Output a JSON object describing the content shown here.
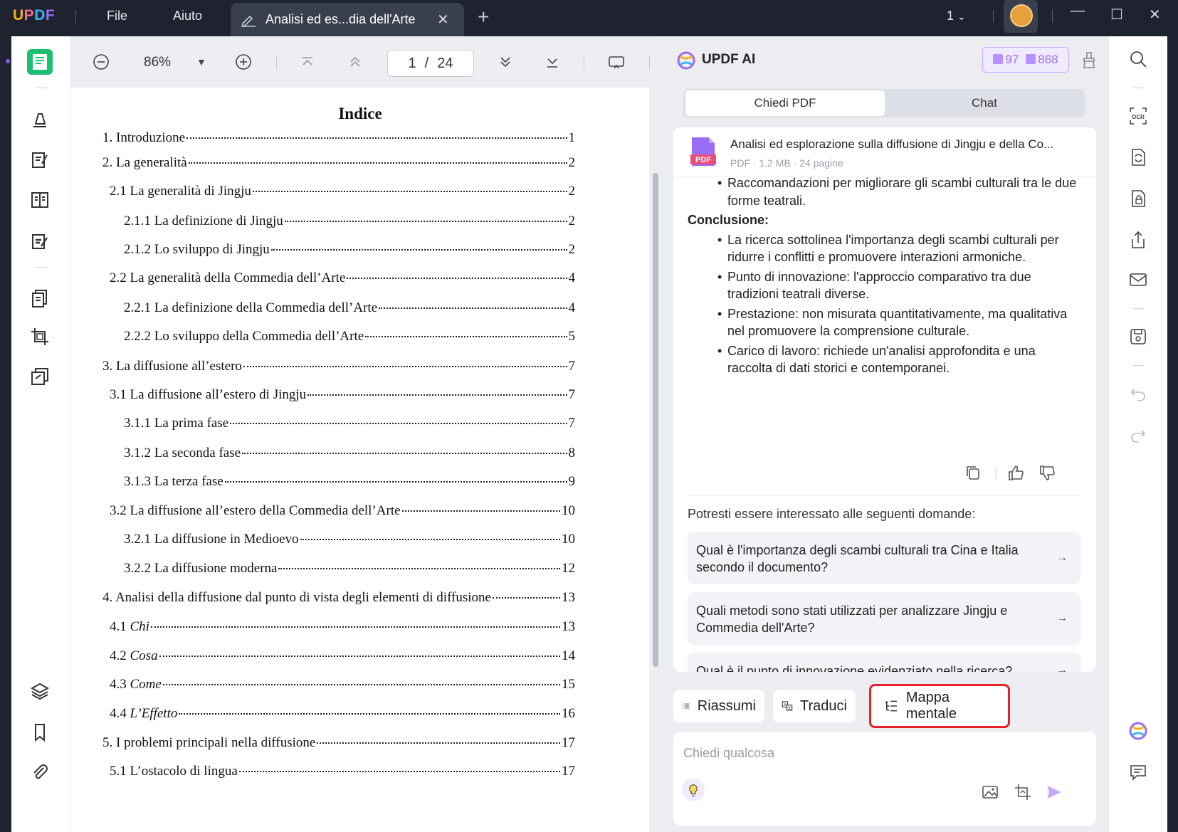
{
  "titlebar": {
    "menu_file": "File",
    "menu_help": "Aiuto",
    "tab_title": "Analisi ed es...dia dell'Arte",
    "page_count": "1",
    "icons": [
      "edit-icon",
      "close-icon",
      "plus-icon",
      "chevron-down-icon",
      "minimize-icon",
      "maximize-icon",
      "window-close-icon"
    ]
  },
  "viewer": {
    "zoom": "86%",
    "current_page": "1",
    "page_sep": "/",
    "total_pages": "24"
  },
  "toc": {
    "title": "Indice",
    "entries": [
      {
        "label": "1. Introduzione",
        "page": "1"
      },
      {
        "label": "2. La generalità",
        "page": "2"
      },
      {
        "label": "2.1 La generalità di Jingju",
        "page": "2"
      },
      {
        "label": "2.1.1 La definizione di Jingju",
        "page": "2"
      },
      {
        "label": "2.1.2 Lo sviluppo di Jingju",
        "page": "2"
      },
      {
        "label": "2.2 La generalità della Commedia dell’Arte",
        "page": "4"
      },
      {
        "label": "2.2.1 La definizione della Commedia dell’Arte",
        "page": "4"
      },
      {
        "label": "2.2.2 Lo sviluppo della Commedia dell’Arte",
        "page": "5"
      },
      {
        "label": "3. La diffusione all’estero",
        "page": "7"
      },
      {
        "label": "3.1 La diffusione all’estero di Jingju",
        "page": "7"
      },
      {
        "label": "3.1.1 La prima fase",
        "page": "7"
      },
      {
        "label": "3.1.2 La seconda fase",
        "page": "8"
      },
      {
        "label": "3.1.3 La terza fase",
        "page": "9"
      },
      {
        "label": "3.2 La diffusione all’estero della Commedia dell’Arte",
        "page": "10"
      },
      {
        "label": "3.2.1 La diffusione in Medioevo",
        "page": "10"
      },
      {
        "label": "3.2.2 La diffusione moderna",
        "page": "12"
      },
      {
        "label": "4. Analisi della diffusione dal punto di vista degli elementi di diffusione",
        "page": "13"
      },
      {
        "label_num": "4.1",
        "label_it": "Chi",
        "page": "13"
      },
      {
        "label_num": "4.2",
        "label_it": "Cosa",
        "page": "14"
      },
      {
        "label_num": "4.3",
        "label_it": "Come",
        "page": "15"
      },
      {
        "label_num": "4.4",
        "label_it": "L’Effetto",
        "page": "16"
      },
      {
        "label": "5. I problemi principali nella diffusione",
        "page": "17"
      },
      {
        "label": "5.1 L’ostacolo di lingua",
        "page": "17"
      }
    ]
  },
  "ai": {
    "title": "UPDF AI",
    "credits_docs": "97",
    "credits_chat": "868",
    "tab_pdf": "Chiedi PDF",
    "tab_chat": "Chat",
    "file_name": "Analisi ed esplorazione sulla diffusione di Jingju e della Co...",
    "file_meta": "PDF · 1.2 MB · 24 pagine",
    "message": {
      "bullet_prev": "Raccomandazioni per migliorare gli scambi culturali tra le due forme teatrali.",
      "heading": "Conclusione:",
      "bullets": [
        "La ricerca sottolinea l'importanza degli scambi culturali per ridurre i conflitti e promuovere interazioni armoniche.",
        "Punto di innovazione: l'approccio comparativo tra due tradizioni teatrali diverse.",
        "Prestazione: non misurata quantitativamente, ma qualitativa nel promuovere la comprensione culturale.",
        "Carico di lavoro: richiede un'analisi approfondita e una raccolta di dati storici e contemporanei."
      ]
    },
    "suggestions_title": "Potresti essere interessato alle seguenti domande:",
    "suggestions": [
      "Qual è l'importanza degli scambi culturali tra Cina e Italia secondo il documento?",
      "Quali metodi sono stati utilizzati per analizzare Jingju e Commedia dell'Arte?",
      "Qual è il punto di innovazione evidenziato nella ricerca?"
    ],
    "quick_summarize": "Riassumi",
    "quick_translate": "Traduci",
    "quick_mindmap": "Mappa mentale",
    "input_placeholder": "Chiedi qualcosa",
    "highlight_color": "#e8212b",
    "accent_color": "#9a6cf3"
  }
}
